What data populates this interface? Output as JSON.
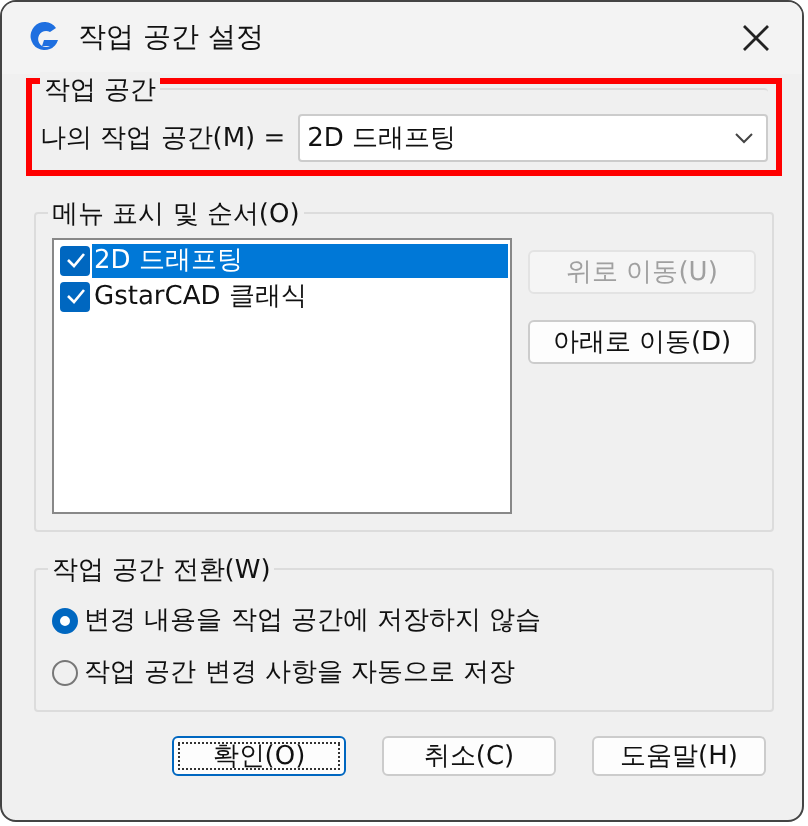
{
  "window": {
    "title": "작업 공간 설정"
  },
  "workspace": {
    "title": "작업 공간",
    "highlighted": true,
    "label": "나의 작업 공간(M) =",
    "value": "2D 드래프팅"
  },
  "menu_order": {
    "title": "메뉴 표시 및 순서(O)",
    "items": [
      {
        "label": "2D 드래프팅",
        "checked": true,
        "selected": true
      },
      {
        "label": "GstarCAD 클래식",
        "checked": true,
        "selected": false
      }
    ],
    "buttons": [
      {
        "label": "위로 이동(U)",
        "disabled": true
      },
      {
        "label": "아래로 이동(D)",
        "disabled": false
      }
    ]
  },
  "switch": {
    "title": "작업 공간 전환(W)",
    "options": [
      {
        "label": "변경 내용을 작업 공간에 저장하지 않습",
        "selected": true
      },
      {
        "label": "작업 공간 변경 사항을 자동으로 저장",
        "selected": false
      }
    ]
  },
  "buttons": [
    {
      "label": "확인(O)",
      "focused": true
    },
    {
      "label": "취소(C)",
      "focused": false
    },
    {
      "label": "도움말(H)",
      "focused": false
    }
  ]
}
